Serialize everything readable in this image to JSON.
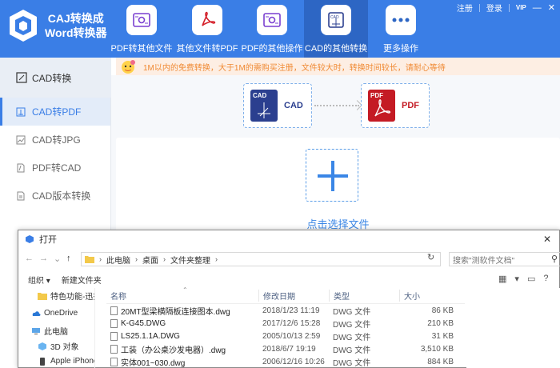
{
  "app": {
    "title_line1": "CAJ转换成",
    "title_line2": "Word转换器"
  },
  "topbar": {
    "nav": [
      {
        "label": "PDF转其他文件",
        "icon": "pdf-gear-icon"
      },
      {
        "label": "其他文件转PDF",
        "icon": "pdf-acrobat-icon"
      },
      {
        "label": "PDF的其他操作",
        "icon": "pdf-settings-icon"
      },
      {
        "label": "CAD的其他转换",
        "icon": "cad-icon"
      },
      {
        "label": "更多操作",
        "icon": "more-dots-icon"
      }
    ],
    "register": "注册",
    "login": "登录",
    "vip": "VIP"
  },
  "colors": {
    "primary": "#3a7ee6",
    "active_nav": "#2d66c4",
    "cad_blue": "#2b3f8f",
    "pdf_red": "#c41b24",
    "notice_orange": "#f08a34"
  },
  "notice": {
    "text": "1M以内的免费转换，大于1M的需购买注册，文件较大时，转换时间较长，请耐心等待"
  },
  "sidebar": {
    "header": "CAD转换",
    "items": [
      {
        "label": "CAD转PDF",
        "active": true
      },
      {
        "label": "CAD转JPG",
        "active": false
      },
      {
        "label": "PDF转CAD",
        "active": false
      },
      {
        "label": "CAD版本转换",
        "active": false
      }
    ]
  },
  "conversion": {
    "from": {
      "tag": "CAD",
      "label": "CAD"
    },
    "to": {
      "tag": "PDF",
      "label": "PDF"
    },
    "choose_file": "点击选择文件"
  },
  "dialog": {
    "title": "打开",
    "breadcrumb": [
      "此电脑",
      "桌面",
      "文件夹整理"
    ],
    "search_placeholder": "搜索\"测软件文档\"",
    "toolbar": {
      "organize": "组织 ▾",
      "new_folder": "新建文件夹"
    },
    "tree": [
      {
        "label": "特色功能-迅捷",
        "icon": "folder-icon"
      },
      {
        "label": "OneDrive",
        "icon": "cloud-icon"
      },
      {
        "label": "此电脑",
        "icon": "computer-icon"
      },
      {
        "label": "3D 对象",
        "icon": "3d-objects-icon"
      },
      {
        "label": "Apple iPhone",
        "icon": "phone-icon"
      }
    ],
    "columns": [
      "名称",
      "修改日期",
      "类型",
      "大小"
    ],
    "files": [
      {
        "name": "20MT型梁横隔板连接图本.dwg",
        "date": "2018/1/23 11:19",
        "type": "DWG 文件",
        "size": "86 KB"
      },
      {
        "name": "K-G45.DWG",
        "date": "2017/12/6 15:28",
        "type": "DWG 文件",
        "size": "210 KB"
      },
      {
        "name": "LS25.1.1A.DWG",
        "date": "2005/10/13 2:59",
        "type": "DWG 文件",
        "size": "31 KB"
      },
      {
        "name": "工装（办公桌沙发电器）.dwg",
        "date": "2018/6/7 19:19",
        "type": "DWG 文件",
        "size": "3,510 KB"
      },
      {
        "name": "实体001~030.dwg",
        "date": "2006/12/16 10:26",
        "type": "DWG 文件",
        "size": "884 KB"
      }
    ]
  }
}
